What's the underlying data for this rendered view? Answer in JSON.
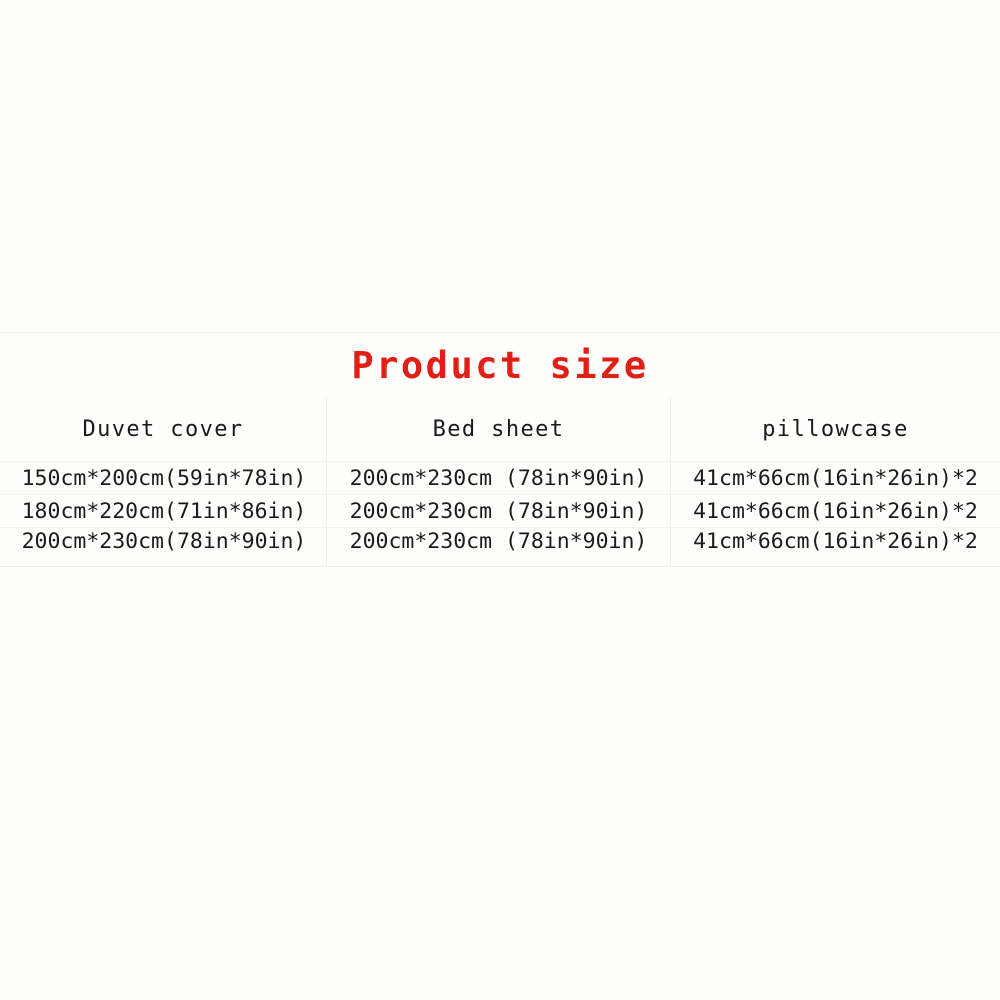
{
  "page": {
    "background_color": "#fefefb"
  },
  "size_table": {
    "title": "Product size",
    "title_color": "#e01f16",
    "columns": [
      {
        "header": "Duvet cover"
      },
      {
        "header": "Bed sheet"
      },
      {
        "header": "pillowcase"
      }
    ],
    "rows": [
      {
        "duvet_cover": "150cm*200cm(59in*78in)",
        "bed_sheet": "200cm*230cm (78in*90in)",
        "pillowcase": "41cm*66cm(16in*26in)*2"
      },
      {
        "duvet_cover": "180cm*220cm(71in*86in)",
        "bed_sheet": "200cm*230cm (78in*90in)",
        "pillowcase": "41cm*66cm(16in*26in)*2"
      },
      {
        "duvet_cover": "200cm*230cm(78in*90in)",
        "bed_sheet": "200cm*230cm (78in*90in)",
        "pillowcase": "41cm*66cm(16in*26in)*2"
      }
    ]
  }
}
